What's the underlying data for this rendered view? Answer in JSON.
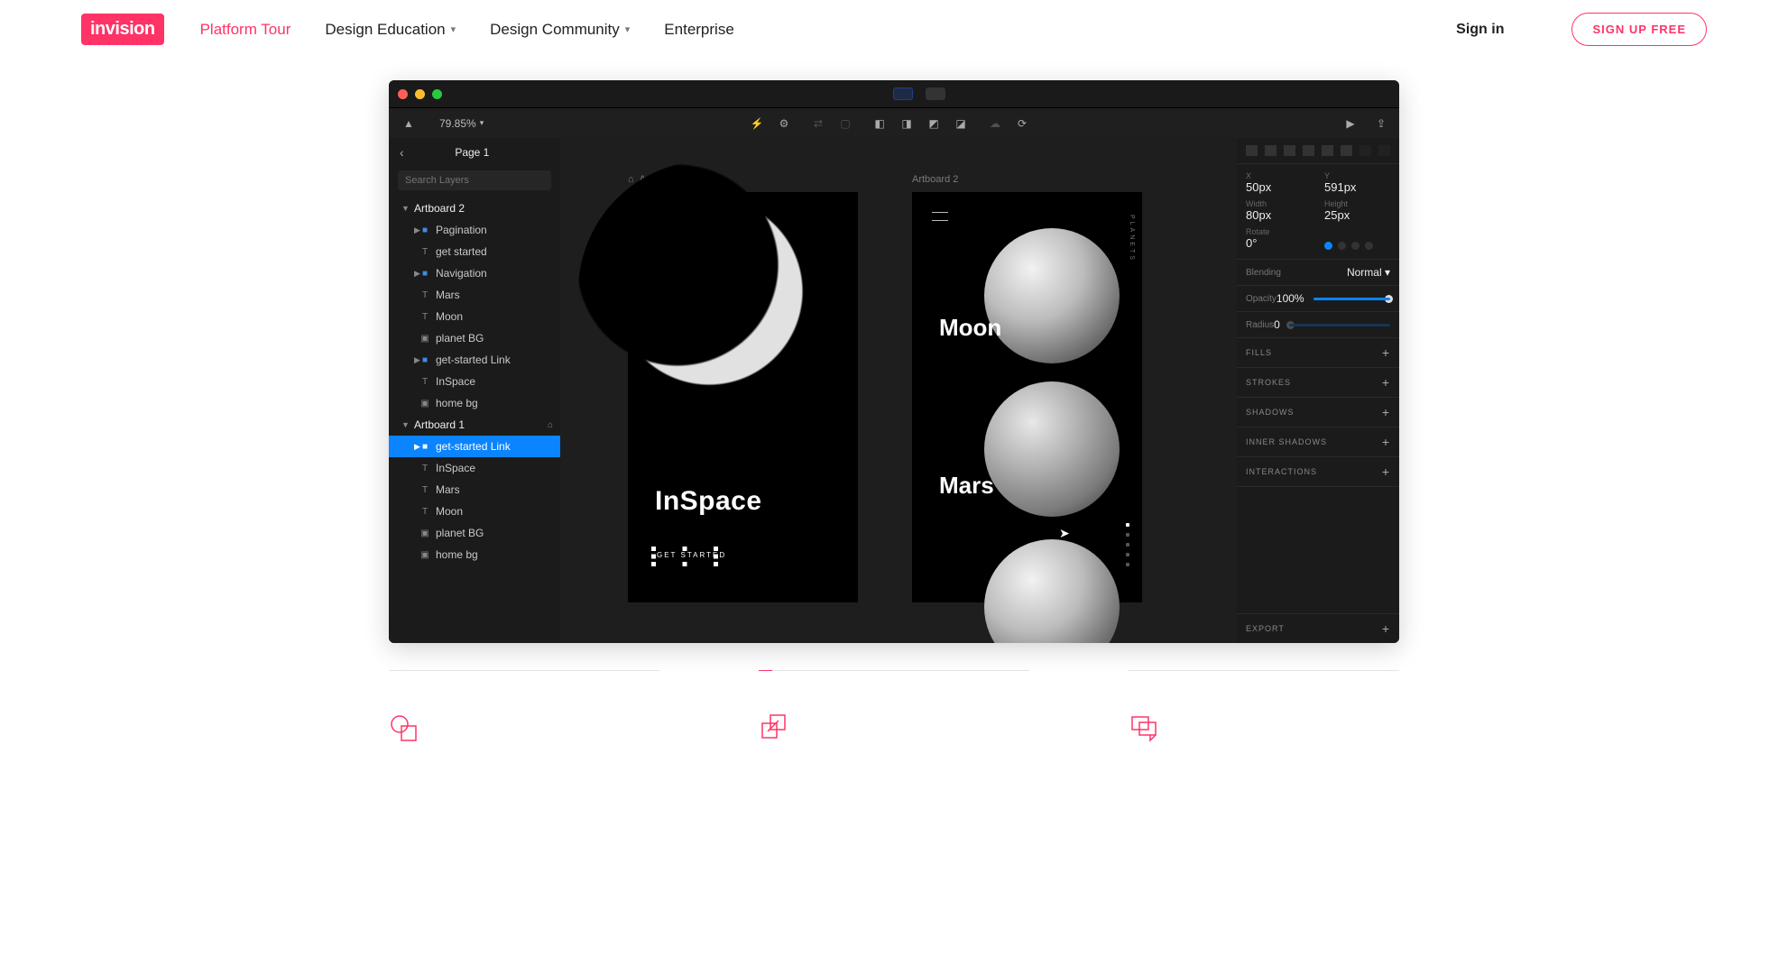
{
  "header": {
    "logo_in": "in",
    "logo_vision": "vision",
    "nav": {
      "platform": "Platform Tour",
      "education": "Design Education",
      "community": "Design Community",
      "enterprise": "Enterprise"
    },
    "signin": "Sign in",
    "signup": "SIGN UP FREE"
  },
  "app": {
    "page_label": "Page 1",
    "search_placeholder": "Search Layers",
    "zoom": "79.85%",
    "layers": {
      "ab2": "Artboard 2",
      "ab2_items": {
        "pagination": "Pagination",
        "get_started": "get started",
        "navigation": "Navigation",
        "mars": "Mars",
        "moon": "Moon",
        "planet_bg": "planet BG",
        "gs_link": "get-started Link",
        "inspace": "InSpace",
        "home_bg": "home bg"
      },
      "ab1": "Artboard 1",
      "ab1_items": {
        "gs_link": "get-started Link",
        "inspace": "InSpace",
        "mars": "Mars",
        "moon": "Moon",
        "planet_bg": "planet BG",
        "home_bg": "home bg"
      }
    },
    "canvas": {
      "ab1_label": "Artboard 1",
      "ab2_label": "Artboard 2",
      "inspace": "InSpace",
      "get_started": "GET STARTED",
      "moon": "Moon",
      "mars": "Mars",
      "side_label": "PLANETS"
    },
    "inspector": {
      "x_k": "X",
      "x_v": "50px",
      "y_k": "Y",
      "y_v": "591px",
      "w_k": "Width",
      "w_v": "80px",
      "h_k": "Height",
      "h_v": "25px",
      "rot_k": "Rotate",
      "rot_v": "0°",
      "blend_k": "Blending",
      "blend_v": "Normal",
      "opac_k": "Opacity",
      "opac_v": "100%",
      "rad_k": "Radius",
      "rad_v": "0",
      "fills": "FILLS",
      "strokes": "STROKES",
      "shadows": "SHADOWS",
      "inner_shadows": "INNER SHADOWS",
      "interactions": "INTERACTIONS",
      "export": "EXPORT"
    }
  }
}
